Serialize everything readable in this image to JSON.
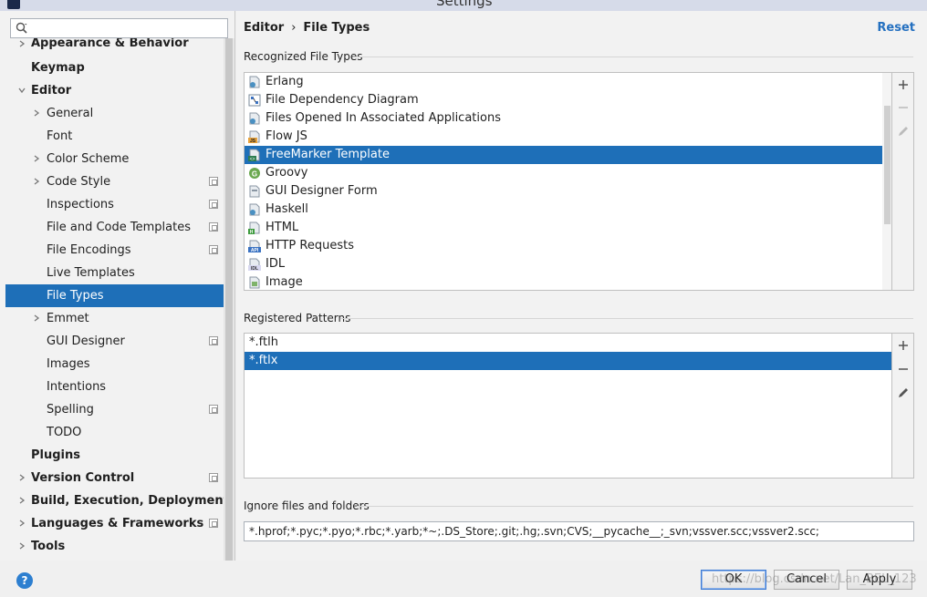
{
  "window": {
    "title": "Settings"
  },
  "search": {
    "placeholder": ""
  },
  "sidebar": {
    "items": [
      {
        "label": "Appearance & Behavior",
        "level": 0,
        "chevron": "right",
        "bold": true,
        "proj": false
      },
      {
        "label": "Keymap",
        "level": 0,
        "chevron": "none",
        "bold": true,
        "proj": false
      },
      {
        "label": "Editor",
        "level": 0,
        "chevron": "down",
        "bold": true,
        "proj": false
      },
      {
        "label": "General",
        "level": 1,
        "chevron": "right",
        "bold": false,
        "proj": false
      },
      {
        "label": "Font",
        "level": 1,
        "chevron": "none",
        "bold": false,
        "proj": false
      },
      {
        "label": "Color Scheme",
        "level": 1,
        "chevron": "right",
        "bold": false,
        "proj": false
      },
      {
        "label": "Code Style",
        "level": 1,
        "chevron": "right",
        "bold": false,
        "proj": true
      },
      {
        "label": "Inspections",
        "level": 1,
        "chevron": "none",
        "bold": false,
        "proj": true
      },
      {
        "label": "File and Code Templates",
        "level": 1,
        "chevron": "none",
        "bold": false,
        "proj": true
      },
      {
        "label": "File Encodings",
        "level": 1,
        "chevron": "none",
        "bold": false,
        "proj": true
      },
      {
        "label": "Live Templates",
        "level": 1,
        "chevron": "none",
        "bold": false,
        "proj": false
      },
      {
        "label": "File Types",
        "level": 1,
        "chevron": "none",
        "bold": false,
        "proj": false,
        "selected": true
      },
      {
        "label": "Emmet",
        "level": 1,
        "chevron": "right",
        "bold": false,
        "proj": false
      },
      {
        "label": "GUI Designer",
        "level": 1,
        "chevron": "none",
        "bold": false,
        "proj": true
      },
      {
        "label": "Images",
        "level": 1,
        "chevron": "none",
        "bold": false,
        "proj": false
      },
      {
        "label": "Intentions",
        "level": 1,
        "chevron": "none",
        "bold": false,
        "proj": false
      },
      {
        "label": "Spelling",
        "level": 1,
        "chevron": "none",
        "bold": false,
        "proj": true
      },
      {
        "label": "TODO",
        "level": 1,
        "chevron": "none",
        "bold": false,
        "proj": false
      },
      {
        "label": "Plugins",
        "level": 0,
        "chevron": "none",
        "bold": true,
        "proj": false
      },
      {
        "label": "Version Control",
        "level": 0,
        "chevron": "right",
        "bold": true,
        "proj": true
      },
      {
        "label": "Build, Execution, Deployment",
        "level": 0,
        "chevron": "right",
        "bold": true,
        "proj": false
      },
      {
        "label": "Languages & Frameworks",
        "level": 0,
        "chevron": "right",
        "bold": true,
        "proj": true
      },
      {
        "label": "Tools",
        "level": 0,
        "chevron": "right",
        "bold": true,
        "proj": false
      }
    ]
  },
  "header": {
    "crumb_parent": "Editor",
    "crumb_sep": "›",
    "crumb_current": "File Types",
    "reset_label": "Reset"
  },
  "recognized": {
    "title": "Recognized File Types",
    "items": [
      {
        "label": "Erlang",
        "icon": "erlang-file-icon"
      },
      {
        "label": "File Dependency Diagram",
        "icon": "diagram-file-icon"
      },
      {
        "label": "Files Opened In Associated Applications",
        "icon": "associated-app-file-icon"
      },
      {
        "label": "Flow JS",
        "icon": "flow-js-file-icon"
      },
      {
        "label": "FreeMarker Template",
        "icon": "freemarker-file-icon",
        "selected": true
      },
      {
        "label": "Groovy",
        "icon": "groovy-file-icon"
      },
      {
        "label": "GUI Designer Form",
        "icon": "gui-form-file-icon"
      },
      {
        "label": "Haskell",
        "icon": "haskell-file-icon"
      },
      {
        "label": "HTML",
        "icon": "html-file-icon"
      },
      {
        "label": "HTTP Requests",
        "icon": "http-requests-file-icon"
      },
      {
        "label": "IDL",
        "icon": "idl-file-icon"
      },
      {
        "label": "Image",
        "icon": "image-file-icon"
      }
    ]
  },
  "patterns": {
    "title": "Registered Patterns",
    "items": [
      {
        "label": "*.ftlh"
      },
      {
        "label": "*.ftlx",
        "selected": true
      }
    ]
  },
  "ignore": {
    "title": "Ignore files and folders",
    "value": "*.hprof;*.pyc;*.pyo;*.rbc;*.yarb;*~;.DS_Store;.git;.hg;.svn;CVS;__pycache__;_svn;vssver.scc;vssver2.scc;"
  },
  "footer": {
    "help_label": "?",
    "ok_label": "OK",
    "cancel_label": "Cancel",
    "apply_label": "Apply",
    "watermark": "https://blog.csdn.net/Lan_BEL_123"
  },
  "colors": {
    "selection": "#1e6fb8",
    "link": "#2470c0"
  }
}
